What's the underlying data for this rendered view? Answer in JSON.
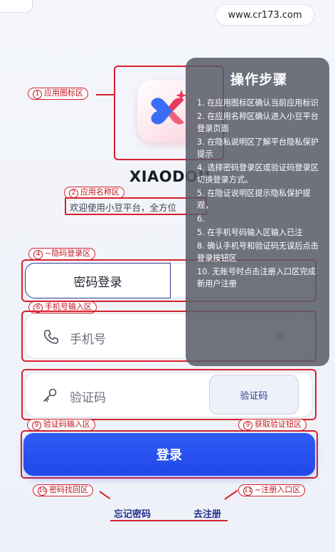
{
  "header": {
    "url": "www.cr173.com"
  },
  "app": {
    "name": "XIAODOU",
    "welcome": "欢迎使用小豆平台，全方位"
  },
  "annotations": {
    "icon_area": {
      "num": "1",
      "text": "应用图标区"
    },
    "name_area": {
      "num": "2",
      "text": "应用名称区"
    },
    "password_login_area": {
      "num": "4",
      "text": "~隐码登录区"
    },
    "phone_area": {
      "num": "6",
      "text": "手机号输入区"
    },
    "code_input_area": {
      "num": "9",
      "text": "验证码输入区"
    },
    "get_code_area": {
      "num": "9",
      "text": "获取验证钮区"
    },
    "forgot_area": {
      "num": "10",
      "text": "密码找回区"
    },
    "register_area": {
      "num": "11",
      "text": "~注册入口区"
    }
  },
  "login": {
    "tab_password": "密码登录",
    "phone_placeholder": "手机号",
    "code_placeholder": "验证码",
    "get_code": "验证码",
    "submit": "登录",
    "forgot": "忘记密码",
    "register": "去注册"
  },
  "steps": {
    "title": "操作步骤",
    "items": [
      "1. 在应用图标区确认当前应用标识",
      "2. 在应用名称区确认进入小豆平台登录页面",
      "3. 在隐私说明区了解平台隐私保护提示",
      "4. 选择密码登录区或验证码登录区切换登录方式。",
      "5. 在隐证说明区提示隐私保护提观，",
      "6.",
      "5. 在手机号码输入区输入已注",
      "8. 确认手机号和验证码无误后点击登录按钮区",
      "10. 无账号时点击注册入口区完成新用户注册"
    ]
  },
  "colors": {
    "accent": "#2148e8",
    "annotation": "#d6212e",
    "overlay": "#585c68"
  }
}
